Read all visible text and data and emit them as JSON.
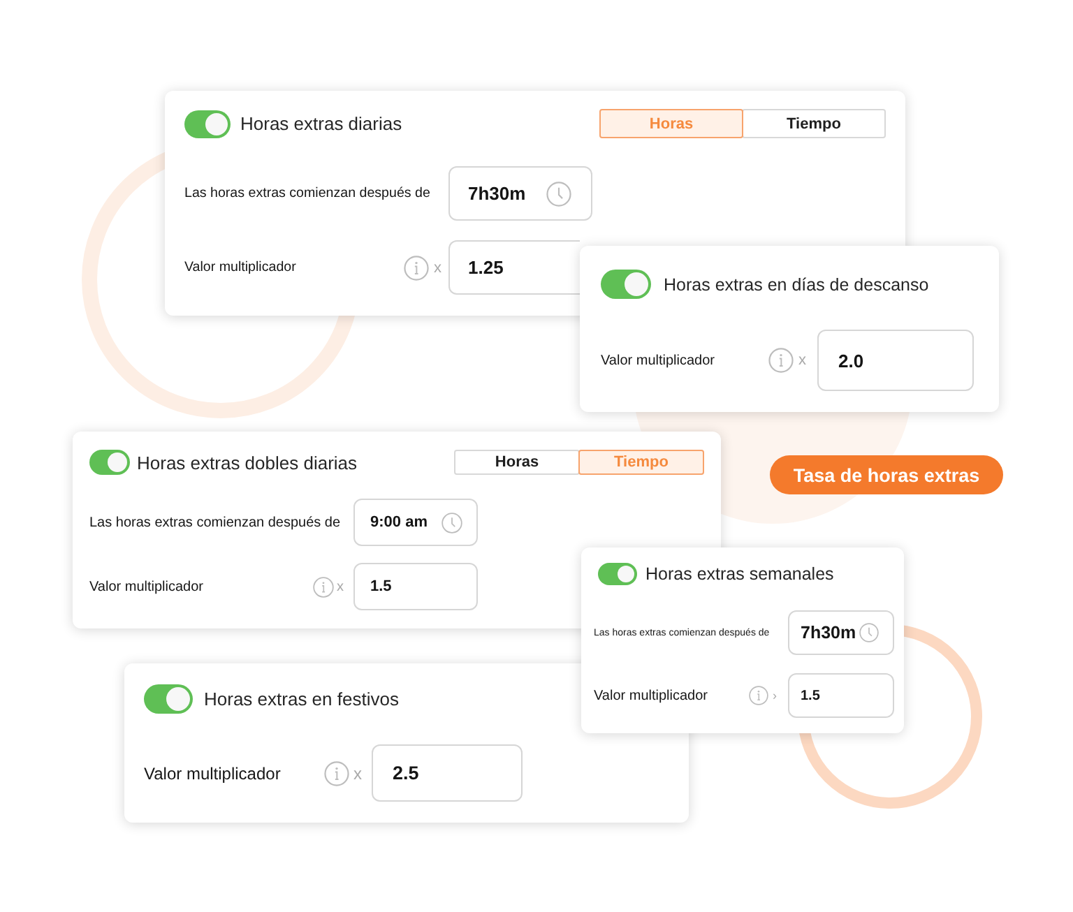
{
  "cards": [
    {
      "title": "Horas extras diarias",
      "on": true,
      "modes": [
        {
          "label": "Horas",
          "selected": true
        },
        {
          "label": "Tiempo",
          "selected": false
        }
      ],
      "rows": [
        {
          "kind": "time",
          "label": "Las horas extras comienzan después de",
          "value": "7h30m"
        },
        {
          "kind": "multiplier",
          "label": "Valor multiplicador",
          "sign": "x",
          "value": "1.25"
        }
      ]
    },
    {
      "title": "Horas extras en días de descanso",
      "on": true,
      "rows": [
        {
          "kind": "multiplier",
          "label": "Valor multiplicador",
          "sign": "x",
          "value": "2.0"
        }
      ]
    },
    {
      "title": "Horas extras dobles diarias",
      "on": true,
      "modes": [
        {
          "label": "Horas",
          "selected": false
        },
        {
          "label": "Tiempo",
          "selected": true
        }
      ],
      "rows": [
        {
          "kind": "time",
          "label": "Las horas extras comienzan después de",
          "value": "9:00 am"
        },
        {
          "kind": "multiplier",
          "label": "Valor multiplicador",
          "sign": "x",
          "value": "1.5"
        }
      ]
    },
    {
      "title": "Horas extras semanales",
      "on": true,
      "rows": [
        {
          "kind": "time",
          "label": "Las horas extras comienzan después de",
          "value": "7h30m"
        },
        {
          "kind": "multiplier",
          "label": "Valor multiplicador",
          "sign": "›",
          "value": "1.5"
        }
      ]
    },
    {
      "title": "Horas extras en festivos",
      "on": true,
      "rows": [
        {
          "kind": "multiplier",
          "label": "Valor multiplicador",
          "sign": "x",
          "value": "2.5"
        }
      ]
    }
  ],
  "action_button": {
    "label": "Tasa de horas extras"
  }
}
